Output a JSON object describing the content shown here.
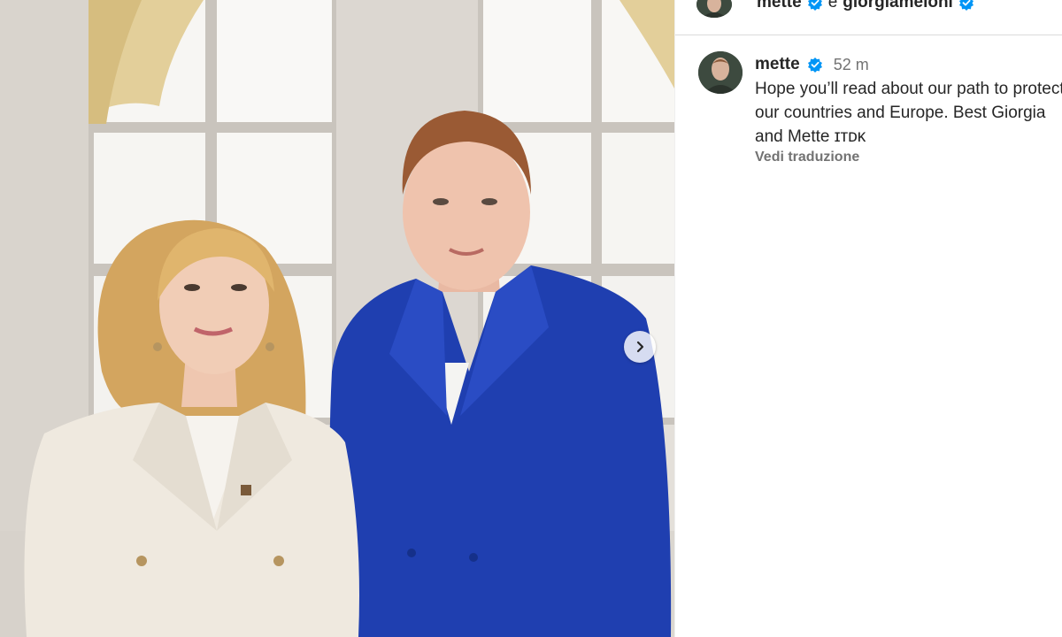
{
  "post": {
    "image": {
      "alt": "",
      "next_icon": "chevron-right-icon"
    }
  },
  "header": {
    "author_1": "mette",
    "conjunction": "e",
    "author_2": "giorgiameloni",
    "verified_icon": "verified-badge-icon"
  },
  "comment": {
    "username": "mette",
    "verified_icon": "verified-badge-icon",
    "time": "52 m",
    "text": "Hope you’ll read about our path to protect our countries and Europe. Best Giorgia and Mette ɪᴛᴅᴋ",
    "translate_label": "Vedi traduzione"
  },
  "colors": {
    "verified": "#0095f6",
    "blue_blazer": "#1f3fb0",
    "white_blazer": "#efe9df"
  }
}
